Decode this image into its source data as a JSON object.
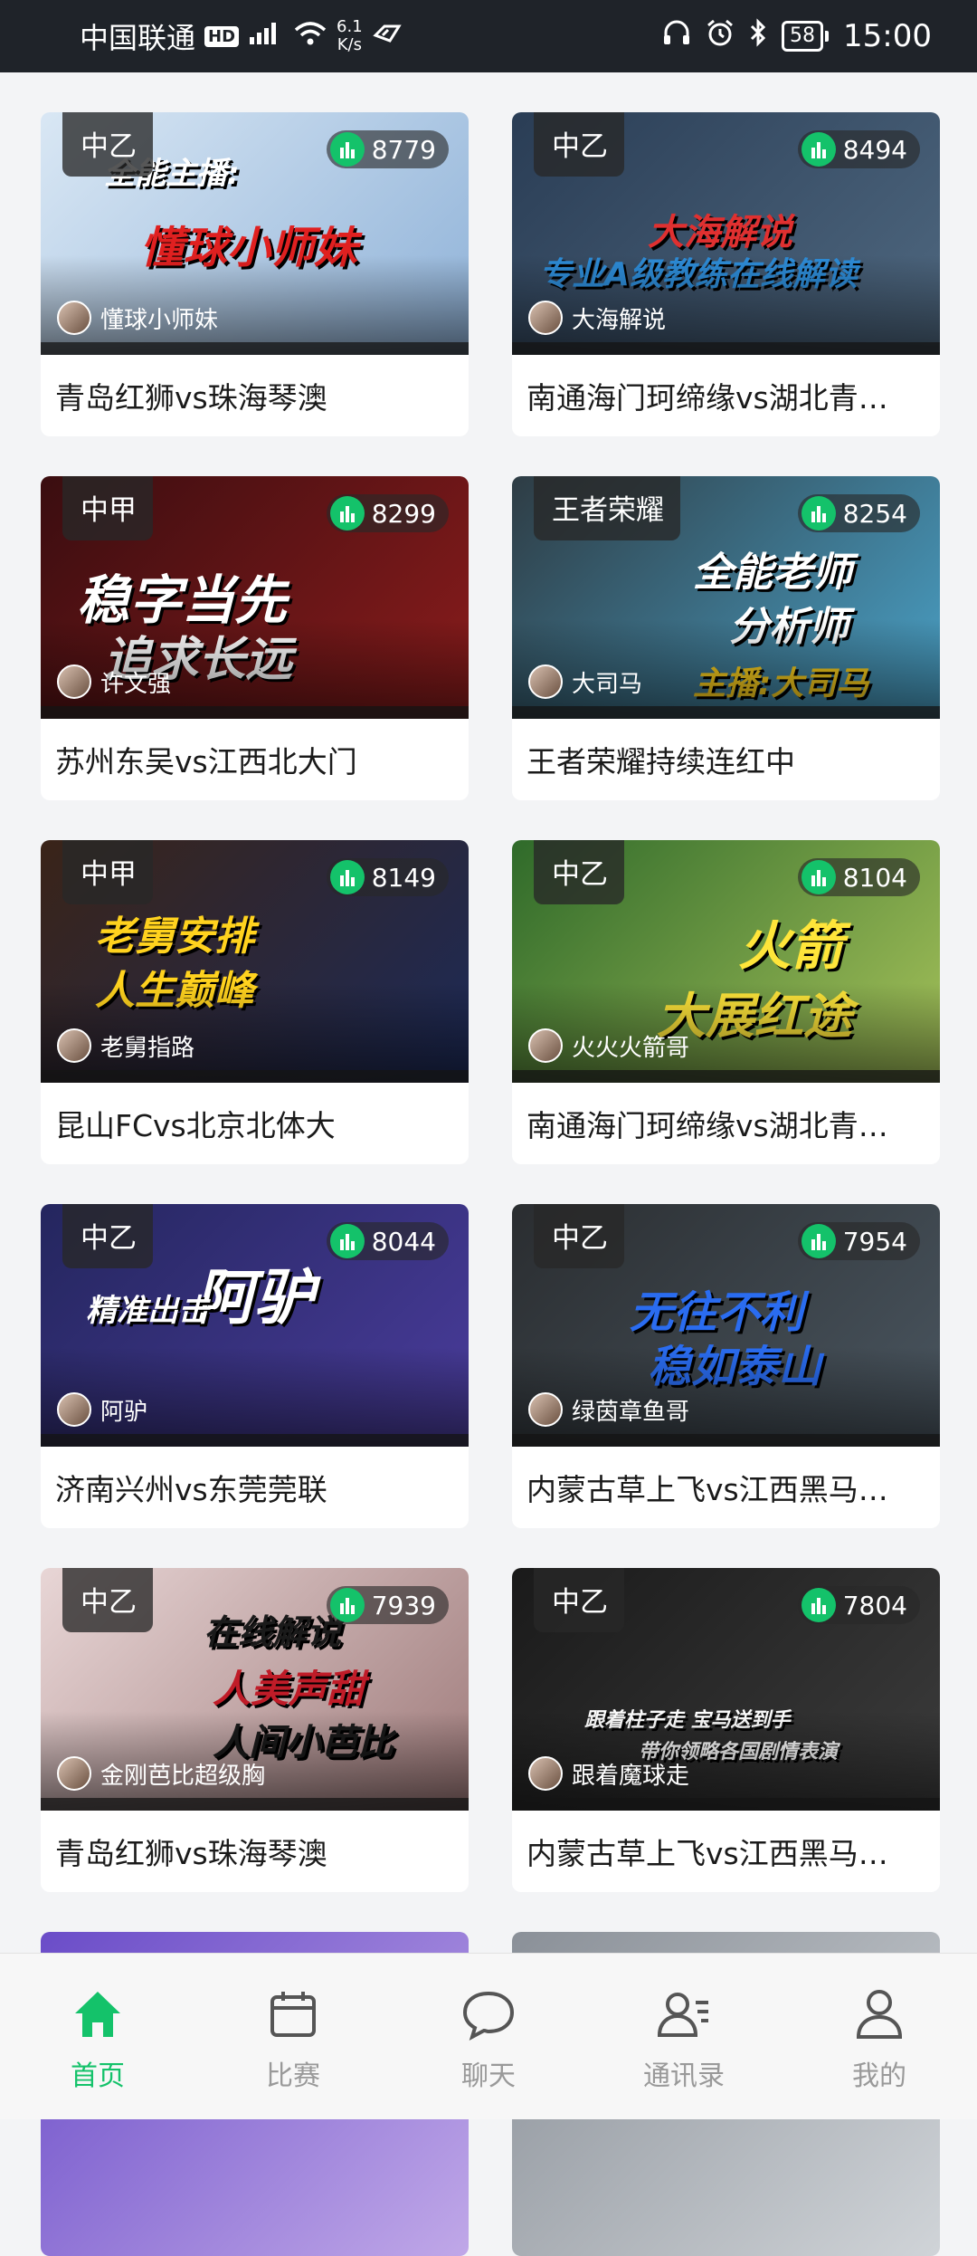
{
  "status_bar": {
    "carrier": "中国联通",
    "hd": "HD",
    "net_speed_value": "6.1",
    "net_speed_unit": "K/s",
    "battery": "58",
    "time": "15:00"
  },
  "cards": [
    {
      "tag": "中乙",
      "viewers": "8779",
      "streamer": "懂球小师妹",
      "title": "青岛红狮vs珠海琴澳",
      "colors": [
        "#d9e7f4",
        "#8fb2d8"
      ],
      "poster": [
        "全能主播:",
        "懂球小师妹"
      ]
    },
    {
      "tag": "中乙",
      "viewers": "8494",
      "streamer": "大海解说",
      "title": "南通海门珂缔缘vs湖北青…",
      "colors": [
        "#2a3d55",
        "#4f6880"
      ],
      "poster": [
        "大海解说",
        "专业A级教练在线解读"
      ]
    },
    {
      "tag": "中甲",
      "viewers": "8299",
      "streamer": "许文强",
      "title": "苏州东吴vs江西北大门",
      "colors": [
        "#3a0d10",
        "#8b1c1c"
      ],
      "poster": [
        "稳字当先",
        "追求长远"
      ]
    },
    {
      "tag": "王者荣耀",
      "viewers": "8254",
      "streamer": "大司马",
      "title": "王者荣耀持续连红中",
      "colors": [
        "#2e3c44",
        "#4aa2c8"
      ],
      "poster": [
        "全能老师",
        "分析师",
        "主播:大司马"
      ]
    },
    {
      "tag": "中甲",
      "viewers": "8149",
      "streamer": "老舅指路",
      "title": "昆山FCvs北京北体大",
      "colors": [
        "#3a2418",
        "#1c2a58"
      ],
      "poster": [
        "老舅安排",
        "人生巅峰"
      ]
    },
    {
      "tag": "中乙",
      "viewers": "8104",
      "streamer": "火火火箭哥",
      "title": "南通海门珂缔缘vs湖北青…",
      "colors": [
        "#2f6a2a",
        "#a6c25a"
      ],
      "poster": [
        "火箭",
        "大展红途"
      ]
    },
    {
      "tag": "中乙",
      "viewers": "8044",
      "streamer": "阿驴",
      "title": "济南兴州vs东莞莞联",
      "colors": [
        "#24265e",
        "#4a3c9c"
      ],
      "poster": [
        "阿驴",
        "精准出击"
      ]
    },
    {
      "tag": "中乙",
      "viewers": "7954",
      "streamer": "绿茵章鱼哥",
      "title": "内蒙古草上飞vs江西黑马…",
      "colors": [
        "#2a2d30",
        "#4a5660"
      ],
      "poster": [
        "无往不利",
        "稳如泰山"
      ]
    },
    {
      "tag": "中乙",
      "viewers": "7939",
      "streamer": "金刚芭比超级胸",
      "title": "青岛红狮vs珠海琴澳",
      "colors": [
        "#e8d6d6",
        "#9e7a7a"
      ],
      "poster": [
        "在线解说",
        "人美声甜",
        "人间小芭比"
      ]
    },
    {
      "tag": "中乙",
      "viewers": "7804",
      "streamer": "跟着魔球走",
      "title": "内蒙古草上飞vs江西黑马…",
      "colors": [
        "#1a1a1a",
        "#3c3c3c"
      ],
      "poster": [
        "跟着柱子走 宝马送到手",
        "带你领略各国剧情表演"
      ]
    }
  ],
  "nav": [
    {
      "label": "首页",
      "icon": "home-icon",
      "active": true
    },
    {
      "label": "比赛",
      "icon": "calendar-icon",
      "active": false
    },
    {
      "label": "聊天",
      "icon": "chat-bubble-icon",
      "active": false
    },
    {
      "label": "通讯录",
      "icon": "contacts-icon",
      "active": false
    },
    {
      "label": "我的",
      "icon": "profile-icon",
      "active": false
    }
  ],
  "accent_color": "#14c26a"
}
